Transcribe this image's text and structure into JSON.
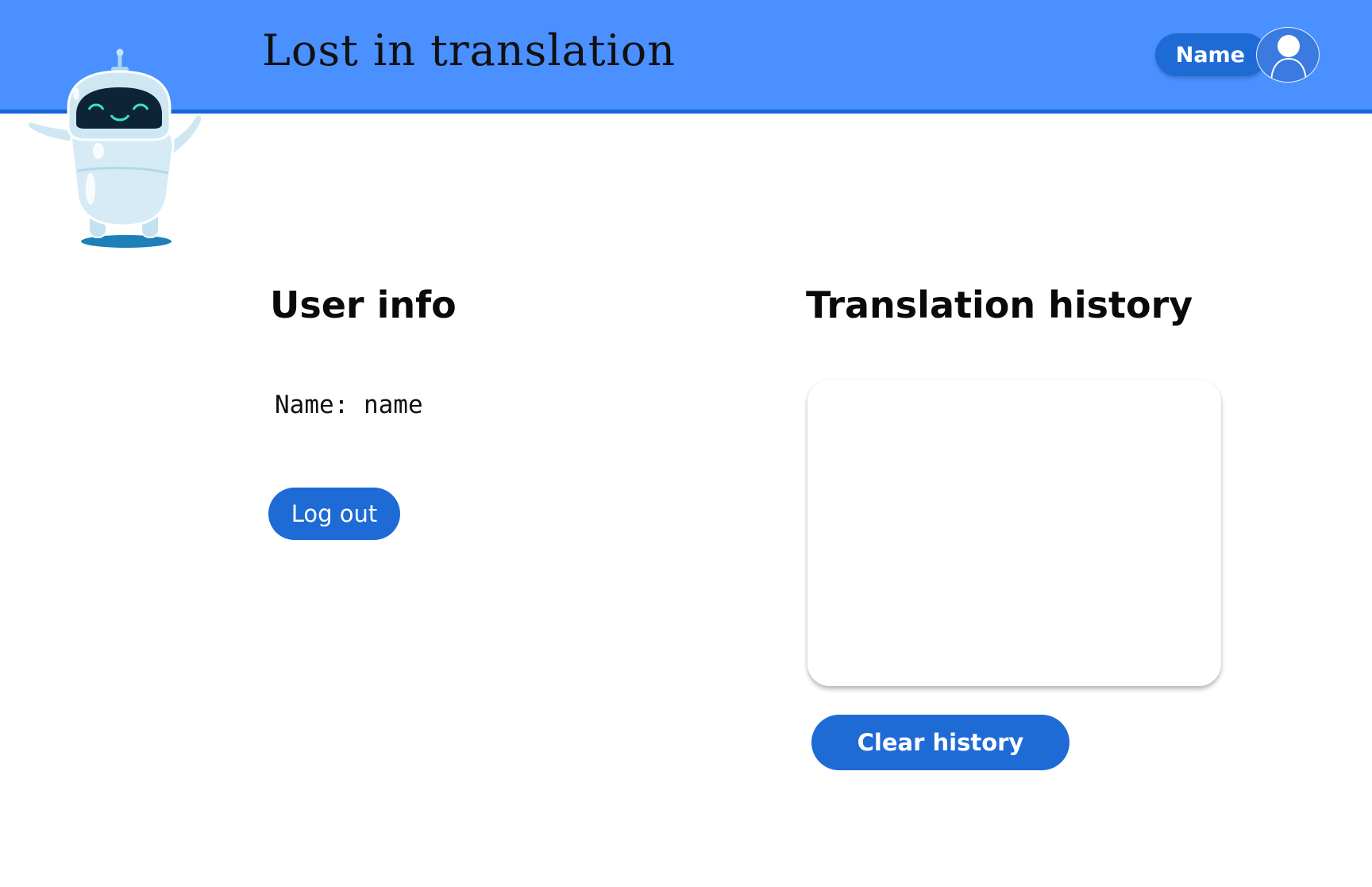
{
  "header": {
    "title": "Lost in translation",
    "user_button_label": "Name",
    "bg_color": "#4a90ff",
    "accent_color": "#1565d8"
  },
  "user_info": {
    "title": "User info",
    "name_line": "Name: name",
    "logout_label": "Log out"
  },
  "history": {
    "title": "Translation history",
    "items": [],
    "clear_label": "Clear history"
  },
  "icons": {
    "avatar": "user-avatar-icon",
    "mascot": "robot-mascot"
  },
  "colors": {
    "button": "#1f6bd6"
  }
}
